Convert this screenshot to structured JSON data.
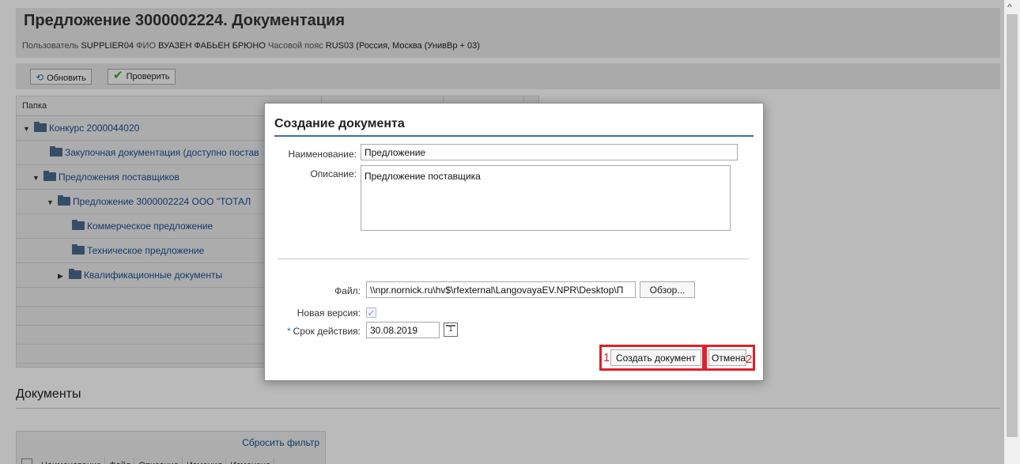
{
  "page": {
    "title": "Предложение 3000002224. Документация",
    "user_bar": {
      "user_label": "Пользователь",
      "user_value": "SUPPLIER04",
      "name_label": "ФИО",
      "name_value": "ВУАЗЕН ФАБЬЕН БРЮНО",
      "tz_label": "Часовой пояс",
      "tz_value": "RUS03 (Россия, Москва (УнивВр + 03)"
    },
    "toolbar": {
      "refresh_label": "Обновить",
      "check_label": "Проверить"
    },
    "tree": {
      "header": "Папка",
      "items": [
        {
          "label": "Конкурс 2000044020",
          "expanded": true
        },
        {
          "label": "Закупочная документация (доступно постав",
          "expanded": null
        },
        {
          "label": "Предложения поставщиков",
          "expanded": true
        },
        {
          "label": "Предложение 3000002224 ООО \"ТОТАЛ",
          "expanded": true
        },
        {
          "label": "Коммерческое предложение",
          "expanded": null
        },
        {
          "label": "Техническое предложение",
          "expanded": null
        },
        {
          "label": "Квалификационные документы",
          "expanded": false
        }
      ]
    },
    "documents": {
      "title": "Документы",
      "reset_filter": "Сбросить фильтр",
      "columns": [
        "Наименование",
        "Файл",
        "Описание",
        "Изменил",
        "Изменено"
      ]
    }
  },
  "dialog": {
    "title": "Создание документа",
    "name_label": "Наименование:",
    "name_value": "Предложение",
    "desc_label": "Описание:",
    "desc_value": "Предложение поставщика",
    "file_label": "Файл:",
    "file_value": "\\\\npr.nornick.ru\\hv$\\rfexternal\\LangovayaEV.NPR\\Desktop\\П",
    "browse_label": "Обзор...",
    "new_version_label": "Новая версия:",
    "new_version_checked": true,
    "required_mark": "*",
    "validity_label": "Срок действия:",
    "validity_value": "30.08.2019",
    "calendar_day": "1",
    "create_label": "Создать документ",
    "cancel_label": "Отмена",
    "annotation_1": "1",
    "annotation_2": "2"
  },
  "colors": {
    "accent_line": "#3d6da6",
    "link": "#1a4f94",
    "highlight": "#e0202a",
    "check_green": "#3ca32f"
  },
  "icons": {
    "refresh": "refresh-icon",
    "check": "checkmark-icon",
    "folder": "folder-icon",
    "calendar": "calendar-icon",
    "caret_down": "caret-down-icon",
    "caret_right": "caret-right-icon"
  }
}
